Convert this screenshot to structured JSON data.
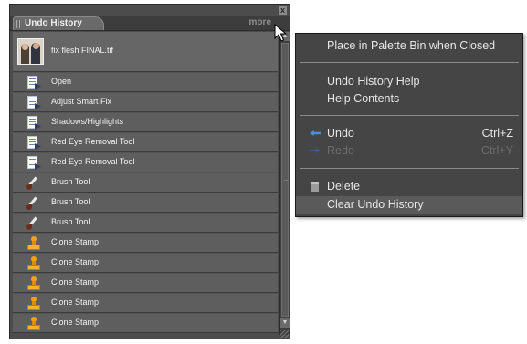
{
  "palette": {
    "tab_label": "Undo History",
    "more_label": "more",
    "close_glyph": "x",
    "snapshot": {
      "label": "fix flesh FINAL.tif"
    },
    "items": [
      {
        "label": "Open",
        "icon": "document-step-icon"
      },
      {
        "label": "Adjust Smart Fix",
        "icon": "document-step-icon"
      },
      {
        "label": "Shadows/Highlights",
        "icon": "document-step-icon"
      },
      {
        "label": "Red Eye Removal Tool",
        "icon": "document-step-icon"
      },
      {
        "label": "Red Eye Removal Tool",
        "icon": "document-step-icon"
      },
      {
        "label": "Brush Tool",
        "icon": "brush-icon"
      },
      {
        "label": "Brush Tool",
        "icon": "brush-icon"
      },
      {
        "label": "Brush Tool",
        "icon": "brush-icon"
      },
      {
        "label": "Clone Stamp",
        "icon": "stamp-icon"
      },
      {
        "label": "Clone Stamp",
        "icon": "stamp-icon"
      },
      {
        "label": "Clone Stamp",
        "icon": "stamp-icon"
      },
      {
        "label": "Clone Stamp",
        "icon": "stamp-icon"
      },
      {
        "label": "Clone Stamp",
        "icon": "stamp-icon"
      }
    ]
  },
  "menu": {
    "place_in_bin": "Place in Palette Bin when Closed",
    "undo_history_help": "Undo History Help",
    "help_contents": "Help Contents",
    "undo": {
      "label": "Undo",
      "shortcut": "Ctrl+Z"
    },
    "redo": {
      "label": "Redo",
      "shortcut": "Ctrl+Y"
    },
    "delete": "Delete",
    "clear_undo_history": "Clear Undo History"
  },
  "colors": {
    "palette_bg": "#4c4c4c",
    "row_bg": "#5e5e5e",
    "menu_bg": "#454545",
    "menu_highlight": "#5a5a5a",
    "undo_icon": "#4a8fd8"
  }
}
